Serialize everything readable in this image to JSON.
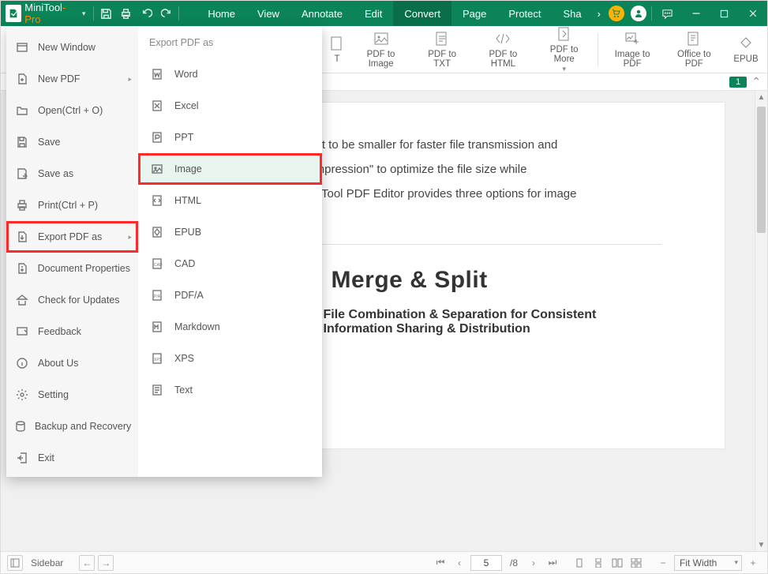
{
  "brand": {
    "name": "MiniTool",
    "suffix": "-Pro"
  },
  "menu": {
    "items": [
      "Home",
      "View",
      "Annotate",
      "Edit",
      "Convert",
      "Page",
      "Protect",
      "Sha"
    ],
    "active_index": 4,
    "overflow_glyph": "›"
  },
  "toolbar": {
    "items": [
      {
        "id": "stub-left",
        "label": "T"
      },
      {
        "id": "pdf-to-image",
        "label": "PDF to Image"
      },
      {
        "id": "pdf-to-txt",
        "label": "PDF to TXT"
      },
      {
        "id": "pdf-to-html",
        "label": "PDF to HTML"
      },
      {
        "id": "pdf-to-more",
        "label": "PDF to More",
        "dropdown": true
      }
    ],
    "right_items": [
      {
        "id": "image-to-pdf",
        "label": "Image to PDF"
      },
      {
        "id": "office-to-pdf",
        "label": "Office to PDF"
      },
      {
        "id": "epub",
        "label": "EPUB"
      }
    ]
  },
  "page_indicator": {
    "badge": "1"
  },
  "file_menu": {
    "col1": [
      {
        "id": "new-window",
        "label": "New Window"
      },
      {
        "id": "new-pdf",
        "label": "New PDF",
        "arrow": true
      },
      {
        "id": "open",
        "label": "Open(Ctrl + O)"
      },
      {
        "id": "save",
        "label": "Save"
      },
      {
        "id": "save-as",
        "label": "Save as"
      },
      {
        "id": "print",
        "label": "Print(Ctrl + P)"
      },
      {
        "id": "export",
        "label": "Export PDF as",
        "arrow": true,
        "highlight": true
      },
      {
        "id": "doc-props",
        "label": "Document Properties"
      },
      {
        "id": "updates",
        "label": "Check for Updates"
      },
      {
        "id": "feedback",
        "label": "Feedback"
      },
      {
        "id": "about",
        "label": "About Us"
      },
      {
        "id": "setting",
        "label": "Setting"
      },
      {
        "id": "backup",
        "label": "Backup and Recovery"
      },
      {
        "id": "exit",
        "label": "Exit"
      }
    ],
    "col2_header": "Export PDF as",
    "col2": [
      {
        "id": "word",
        "label": "Word"
      },
      {
        "id": "excel",
        "label": "Excel"
      },
      {
        "id": "ppt",
        "label": "PPT"
      },
      {
        "id": "image",
        "label": "Image",
        "highlight": true
      },
      {
        "id": "html",
        "label": "HTML"
      },
      {
        "id": "epub",
        "label": "EPUB"
      },
      {
        "id": "cad",
        "label": "CAD"
      },
      {
        "id": "pdfa",
        "label": "PDF/A"
      },
      {
        "id": "markdown",
        "label": "Markdown"
      },
      {
        "id": "xps",
        "label": "XPS"
      },
      {
        "id": "text",
        "label": "Text"
      }
    ]
  },
  "doc": {
    "line1": "ant it to be smaller for faster file transmission and",
    "line2": "Compression\" to optimize the file size while",
    "line3": "MiniTool PDF Editor provides three options for image",
    "h1": "Merge & Split",
    "h3": "File Combination & Separation for Consistent Information Sharing & Distribution"
  },
  "status": {
    "sidebar_label": "Sidebar",
    "page_current": "5",
    "page_total": "/8",
    "zoom_label": "Fit Width"
  }
}
